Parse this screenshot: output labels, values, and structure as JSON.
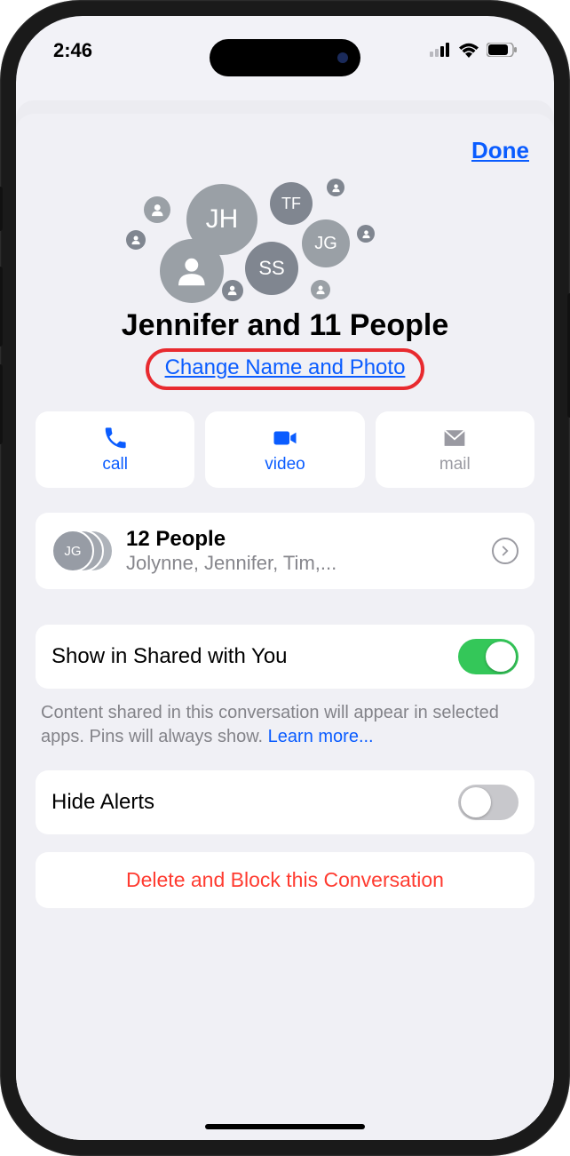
{
  "status": {
    "time": "2:46"
  },
  "header": {
    "done": "Done"
  },
  "group": {
    "title": "Jennifer and 11 People",
    "change_label": "Change Name and Photo",
    "avatars": {
      "jh": "JH",
      "tf": "TF",
      "jg": "JG",
      "ss": "SS"
    }
  },
  "actions": {
    "call": "call",
    "video": "video",
    "mail": "mail"
  },
  "people": {
    "count_label": "12 People",
    "names": "Jolynne, Jennifer, Tim,...",
    "mini": "JG"
  },
  "shared": {
    "label": "Show in Shared with You",
    "help": "Content shared in this conversation will appear in selected apps. Pins will always show. ",
    "learn_more": "Learn more..."
  },
  "alerts": {
    "label": "Hide Alerts"
  },
  "delete": {
    "label": "Delete and Block this Conversation"
  }
}
